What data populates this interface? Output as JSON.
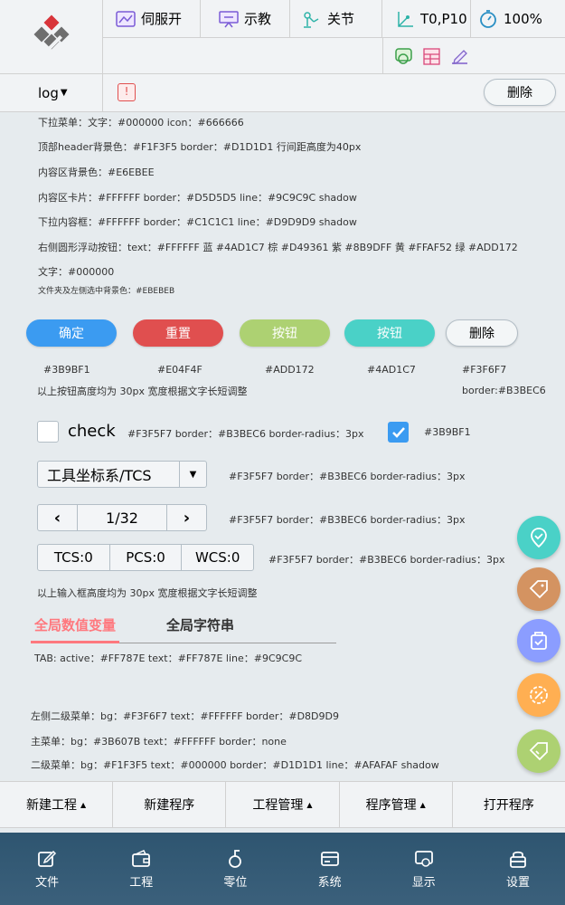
{
  "header": {
    "servo": "伺服开",
    "teach": "示教",
    "joint": "关节",
    "tool": "T0,P10",
    "speed": "100%",
    "log": "log",
    "delete": "删除"
  },
  "notes": {
    "n1": "下拉菜单：文字：#000000    icon：#666666",
    "n2": "顶部header背景色：#F1F3F5  border：#D1D1D1   行间距高度为40px",
    "n3": "内容区背景色：#E6EBEE",
    "n4": "内容区卡片：#FFFFFF    border：#D5D5D5   line：#9C9C9C    shadow",
    "n5": "下拉内容框：#FFFFFF    border：#C1C1C1   line：#D9D9D9    shadow",
    "n6": "右侧圆形浮动按钮：text：#FFFFFF  蓝 #4AD1C7  棕 #D49361  紫 #8B9DFF  黄 #FFAF52  绿 #ADD172",
    "n7": "文字：#000000",
    "n8": "文件夹及左侧选中背景色：#EBEBEB",
    "n9": "以上按钮高度均为 30px  宽度根据文字长短调整",
    "n9b": "border:#B3BEC6",
    "n10": "#F3F5F7    border：#B3BEC6     border-radius：3px",
    "n10b": "#3B9BF1",
    "n11": "#F3F5F7     border：#B3BEC6     border-radius：3px",
    "n12": "#F3F5F7     border：#B3BEC6     border-radius：3px",
    "n13": "#F3F5F7     border：#B3BEC6     border-radius：3px",
    "n14": "以上输入框高度均为 30px  宽度根据文字长短调整",
    "n15": "TAB:    active：#FF787E      text：#FF787E        line：#9C9C9C",
    "n16": "左侧二级菜单：bg：#F3F6F7  text：#FFFFFF  border：#D8D9D9",
    "n17": "主菜单：bg：#3B607B  text：#FFFFFF  border：none",
    "n18": "二级菜单：bg：#F1F3F5  text：#000000  border：#D1D1D1   line：#AFAFAF   shadow"
  },
  "buttons": [
    {
      "label": "确定",
      "color": "#3B9BF1",
      "code": "#3B9BF1"
    },
    {
      "label": "重置",
      "color": "#E04F4F",
      "code": "#E04F4F"
    },
    {
      "label": "按钮",
      "color": "#ADD172",
      "code": "#ADD172"
    },
    {
      "label": "按钮",
      "color": "#4AD1C7",
      "code": "#4AD1C7"
    },
    {
      "label": "删除",
      "color": "#F3F6F7",
      "code": "#F3F6F7"
    }
  ],
  "checkbox": {
    "label": "check"
  },
  "select": {
    "value": "工具坐标系/TCS"
  },
  "pager": {
    "value": "1/32"
  },
  "coords": {
    "tcs": "TCS:0",
    "pcs": "PCS:0",
    "wcs": "WCS:0"
  },
  "tabs": [
    {
      "label": "全局数值变量",
      "active": true
    },
    {
      "label": "全局字符串",
      "active": false
    }
  ],
  "fab_colors": [
    "#4AD1C7",
    "#D49361",
    "#8B9DFF",
    "#FFAF52",
    "#ADD172"
  ],
  "fab_icons": [
    "location-check-icon",
    "tag-icon",
    "box-check-icon",
    "badge-percent-icon",
    "tag-check-icon"
  ],
  "submenu": [
    {
      "label": "新建工程",
      "caret": true
    },
    {
      "label": "新建程序",
      "caret": false
    },
    {
      "label": "工程管理",
      "caret": true
    },
    {
      "label": "程序管理",
      "caret": true
    },
    {
      "label": "打开程序",
      "caret": false
    }
  ],
  "mainmenu": [
    {
      "label": "文件",
      "icon": "edit-icon"
    },
    {
      "label": "工程",
      "icon": "wallet-icon"
    },
    {
      "label": "零位",
      "icon": "zero-icon"
    },
    {
      "label": "系统",
      "icon": "card-icon"
    },
    {
      "label": "显示",
      "icon": "display-icon"
    },
    {
      "label": "设置",
      "icon": "lock-icon"
    }
  ]
}
